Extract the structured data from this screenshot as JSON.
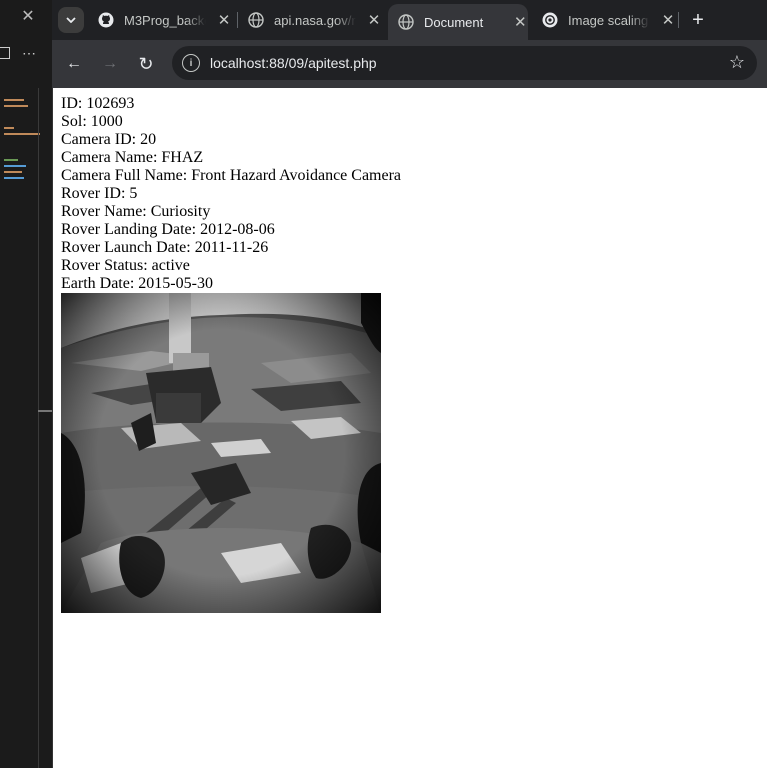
{
  "editor_panel": {
    "close_glyph": "✕",
    "more_glyph": "⋯"
  },
  "browser": {
    "tabs": [
      {
        "title": "M3Prog_backe",
        "icon": "github-icon",
        "active": false
      },
      {
        "title": "api.nasa.gov/r",
        "icon": "globe-icon",
        "active": false
      },
      {
        "title": "Document",
        "icon": "globe-icon",
        "active": true
      },
      {
        "title": "Image scaling",
        "icon": "openai-icon",
        "active": false
      }
    ],
    "close_glyph": "✕",
    "new_tab_glyph": "+",
    "back_glyph": "←",
    "forward_glyph": "→",
    "reload_glyph": "↻",
    "url": "localhost:88/09/apitest.php",
    "bookmark_glyph": "☆"
  },
  "photo_info": {
    "id": "ID: 102693",
    "sol": "Sol: 1000",
    "camera_id": "Camera ID: 20",
    "camera_name": "Camera Name: FHAZ",
    "camera_full_name": "Camera Full Name: Front Hazard Avoidance Camera",
    "rover_id": "Rover ID: 5",
    "rover_name": "Rover Name: Curiosity",
    "rover_landing_date": "Rover Landing Date: 2012-08-06",
    "rover_launch_date": "Rover Launch Date: 2011-11-26",
    "rover_status": "Rover Status: active",
    "earth_date": "Earth Date: 2015-05-30"
  }
}
